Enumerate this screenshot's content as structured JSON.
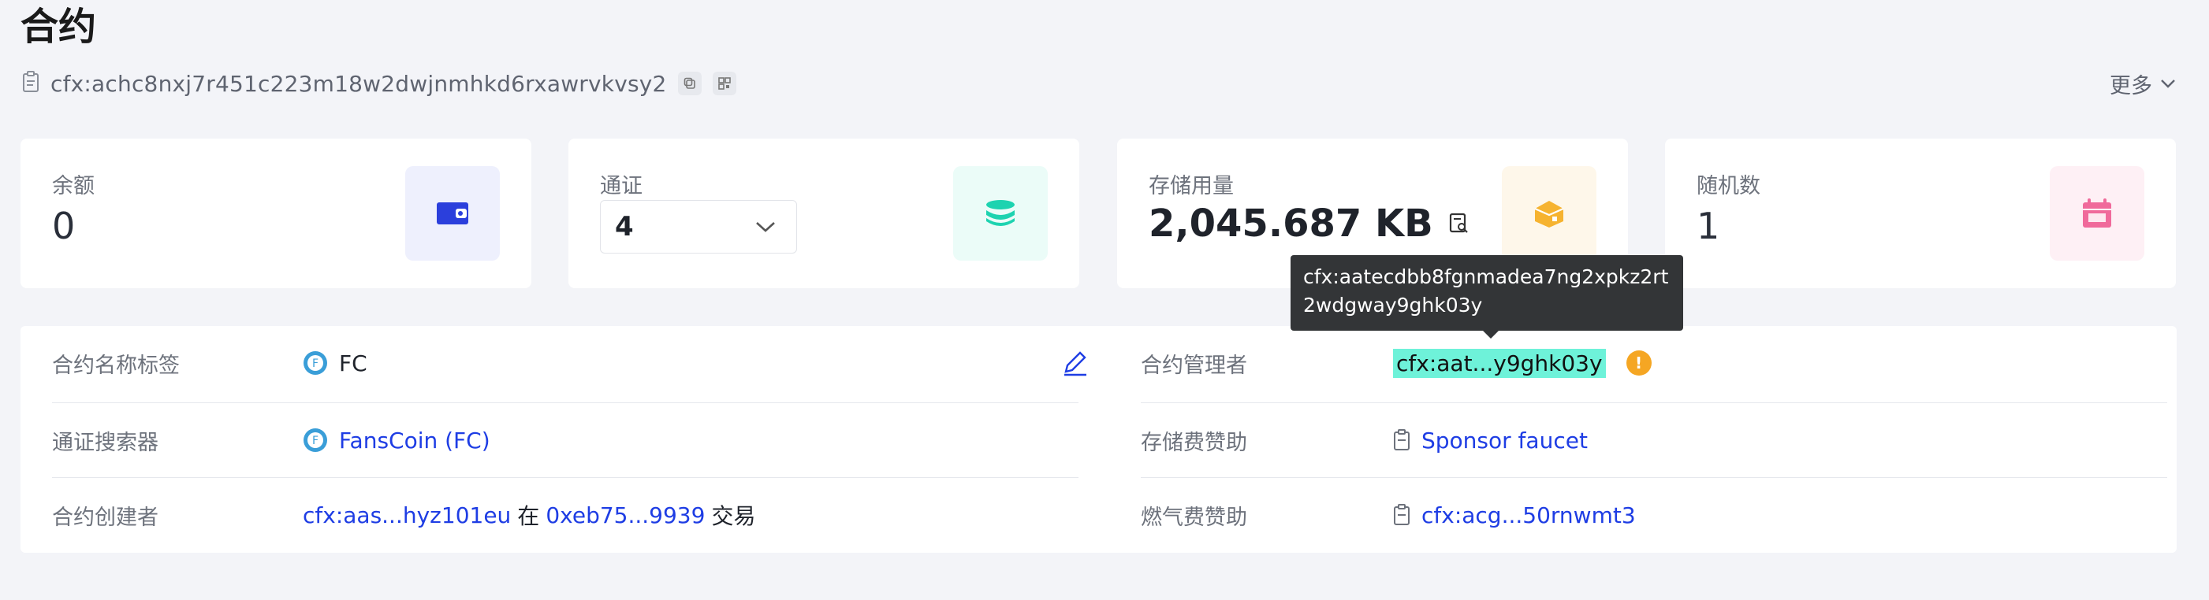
{
  "page": {
    "title": "合约"
  },
  "address_bar": {
    "address": "cfx:achc8nxj7r451c223m18w2dwjnmhkd6rxawrvkvsy2",
    "more_label": "更多"
  },
  "cards": {
    "balance": {
      "label": "余额",
      "value": "0",
      "icon": "wallet-icon",
      "accent": "#2b3fdc"
    },
    "tokens": {
      "label": "通证",
      "selected": "4",
      "icon": "coins-stack-icon",
      "accent": "#1dd3b0"
    },
    "storage": {
      "label": "存储用量",
      "value": "2,045.687 KB",
      "icon": "box-icon",
      "accent": "#f6b330"
    },
    "nonce": {
      "label": "随机数",
      "value": "1",
      "icon": "calendar-icon",
      "accent": "#f06a9b"
    }
  },
  "details": {
    "left": {
      "name_tag": {
        "label": "合约名称标签",
        "value": "FC"
      },
      "token_tracker": {
        "label": "通证搜索器",
        "value": "FansCoin (FC)"
      },
      "creator": {
        "label": "合约创建者",
        "address": "cfx:aas...hyz101eu",
        "in_text": "在",
        "tx": "0xeb75...9939",
        "tx_text": "交易"
      }
    },
    "right": {
      "admin": {
        "label": "合约管理者",
        "value": "cfx:aat...y9ghk03y"
      },
      "storage_sponsor": {
        "label": "存储费赞助",
        "value": "Sponsor faucet"
      },
      "gas_sponsor": {
        "label": "燃气费赞助",
        "value": "cfx:acg...50rnwmt3"
      }
    }
  },
  "tooltip": {
    "text": "cfx:aatecdbb8fgnmadea7ng2xpkz2rt2wdgway9ghk03y"
  }
}
